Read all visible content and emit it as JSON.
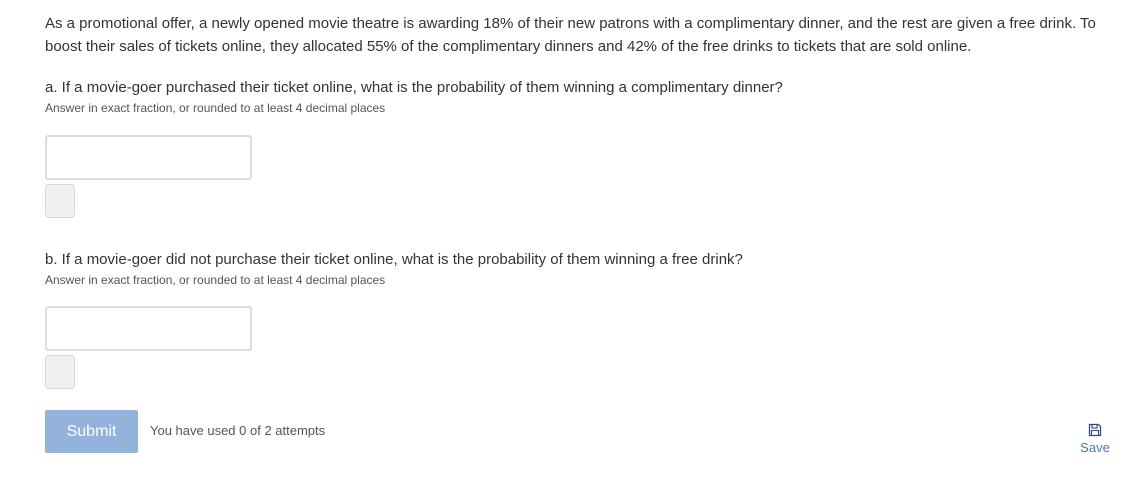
{
  "intro": {
    "text": "As a promotional offer, a newly opened movie theatre is awarding 18% of their new patrons with a complimentary dinner, and the rest are given a free drink. To boost their sales of tickets online, they allocated 55% of the complimentary dinners and 42% of the free drinks to tickets that are sold online."
  },
  "parts": [
    {
      "question": "a. If a movie-goer purchased their ticket online, what is the probability of them winning a complimentary dinner?",
      "hint": "Answer in exact fraction, or rounded to at least 4 decimal places",
      "answer_value": ""
    },
    {
      "question": "b. If a movie-goer did not purchase their ticket online, what is the probability of them winning a free drink?",
      "hint": "Answer in exact fraction, or rounded to at least 4 decimal places",
      "answer_value": ""
    }
  ],
  "footer": {
    "submit_label": "Submit",
    "attempts_text": "You have used 0 of 2 attempts",
    "save_label": "Save",
    "save_icon": "floppy-disk-icon"
  },
  "colors": {
    "submit_bg": "#94b3dc",
    "link": "#4a79b0",
    "text": "#333333"
  }
}
